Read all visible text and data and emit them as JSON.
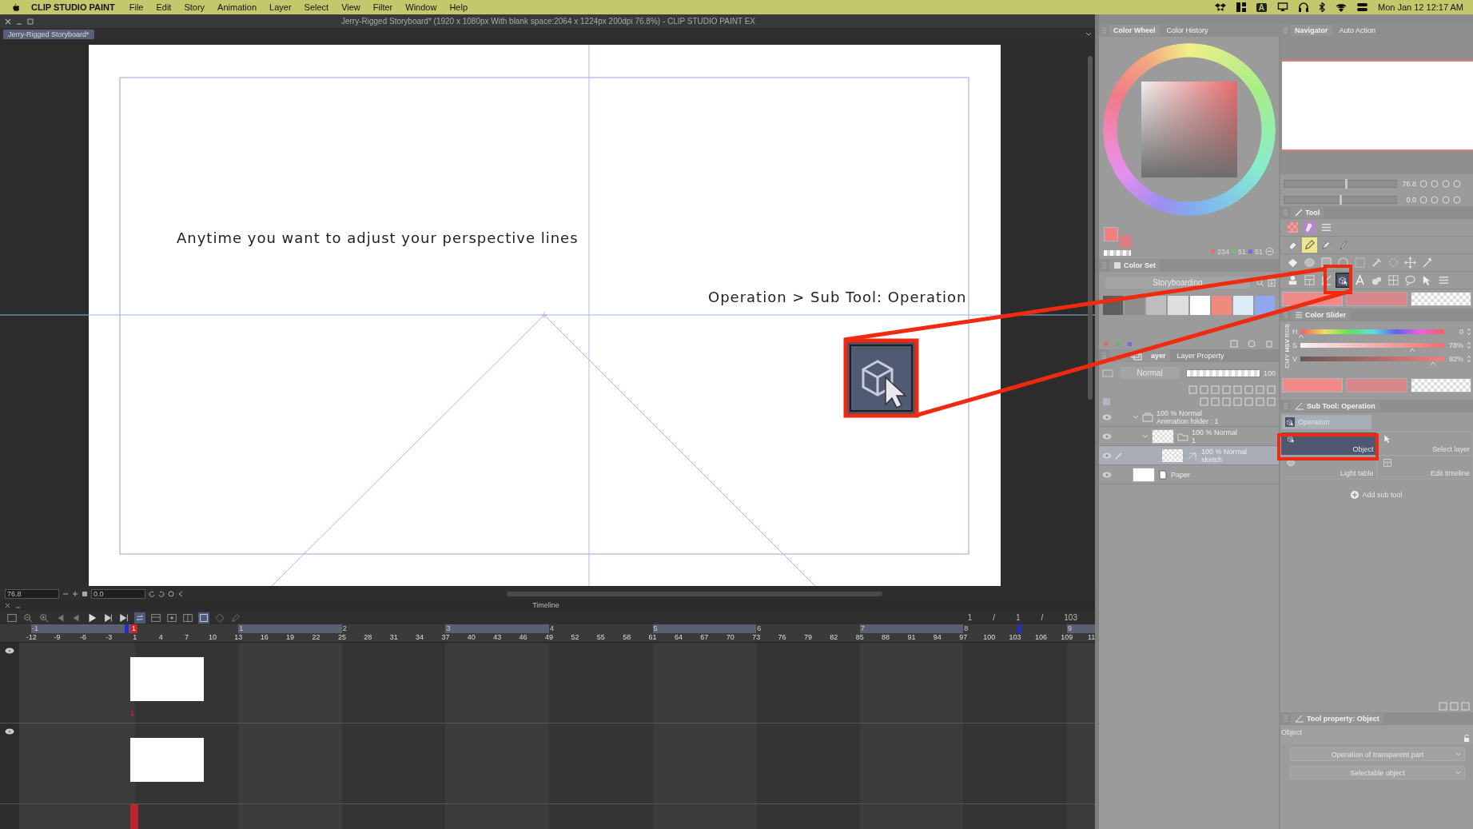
{
  "menu_bar": {
    "app_name": "CLIP STUDIO PAINT",
    "menus": [
      "File",
      "Edit",
      "Story",
      "Animation",
      "Layer",
      "Select",
      "View",
      "Filter",
      "Window",
      "Help"
    ],
    "input_source": "A",
    "clock": "Mon Jan 12  12:17 AM"
  },
  "window": {
    "title": "Jerry-Rigged Storyboard* (1920 x 1080px With blank space:2064 x 1224px 200dpi 76.8%)  - CLIP STUDIO PAINT EX"
  },
  "document_tab": {
    "label": "Jerry-Rigged Storyboard*",
    "selected": true
  },
  "canvas": {
    "captions": [
      "Anytime you want to adjust your perspective lines",
      "Operation > Sub Tool: Operation"
    ]
  },
  "canvas_status": {
    "zoom": "76.8",
    "angle": "0.0"
  },
  "timeline": {
    "title": "Timeline",
    "frame_counter": [
      "1",
      "/",
      "1",
      "/",
      "103"
    ],
    "major_marks": [
      "-1",
      "1",
      "2",
      "3",
      "4",
      "5",
      "6",
      "7",
      "8",
      "9"
    ],
    "minor_marks": [
      "-12",
      "-9",
      "-6",
      "-3",
      "1",
      "4",
      "7",
      "10",
      "13",
      "16",
      "19",
      "22",
      "25",
      "28",
      "31",
      "34",
      "37",
      "40",
      "43",
      "46",
      "49",
      "52",
      "55",
      "58",
      "61",
      "64",
      "67",
      "70",
      "73",
      "76",
      "79",
      "82",
      "85",
      "88",
      "91",
      "94",
      "97",
      "100",
      "103",
      "106",
      "109",
      "11"
    ],
    "playhead_label": "1",
    "tracks": [
      {
        "visible": true,
        "cell_label": "1"
      },
      {
        "visible": true
      }
    ]
  },
  "color_wheel_panel": {
    "tabs": [
      {
        "label": "Color Wheel",
        "selected": true
      },
      {
        "label": "Color History",
        "selected": false
      }
    ],
    "rgb": [
      "234",
      "51",
      "51"
    ]
  },
  "color_set_panel": {
    "title": "Color Set",
    "set_name": "Storyboarding",
    "swatches": [
      {
        "color": "#5e5e5e"
      },
      {
        "color": "#8e8e8e"
      },
      {
        "color": "#bdbdbd"
      },
      {
        "color": "#dedede"
      },
      {
        "color": "#ffffff"
      },
      {
        "color": "#f08a7e"
      },
      {
        "color": "#dcecf7"
      },
      {
        "color": "#8fa8ee"
      }
    ]
  },
  "layer_panel": {
    "tabs": [
      {
        "label": "ayer",
        "selected": true
      },
      {
        "label": "Layer Property",
        "selected": false
      }
    ],
    "blend_mode": "Normal",
    "opacity": "100",
    "opacity_slider": {
      "level": 1
    },
    "layers": [
      {
        "kind": "animation-folder",
        "mode": "100 % Normal",
        "name": "Animation folder : 1",
        "selected": false,
        "expanded": true,
        "children": [
          {
            "kind": "folder",
            "mode": "100 % Normal",
            "name": "1",
            "selected": false,
            "expanded": true,
            "children": [
              {
                "kind": "raster",
                "mode": "100 % Normal",
                "name": "sketch",
                "selected": true
              }
            ]
          }
        ]
      },
      {
        "kind": "paper",
        "name": "Paper",
        "selected": false
      }
    ]
  },
  "navigator_panel": {
    "tabs": [
      {
        "label": "Navigator",
        "selected": true
      },
      {
        "label": "Auto Action",
        "selected": false
      }
    ],
    "sliders": [
      {
        "reading": "76.8",
        "level": 0.55
      },
      {
        "reading": "0.0",
        "level": 0.5
      }
    ]
  },
  "tool_panel": {
    "title": "Tool",
    "rows": [
      [
        {
          "kind": "pattern",
          "selected": false,
          "highlighted": false
        },
        {
          "kind": "bottle",
          "selected": false,
          "highlighted": false
        },
        {
          "kind": "menu",
          "selected": false,
          "highlighted": false
        }
      ],
      [
        {
          "kind": "eraser",
          "selected": false,
          "highlighted": false
        },
        {
          "kind": "pencil",
          "selected": false,
          "highlighted": true
        },
        {
          "kind": "pen",
          "selected": false,
          "highlighted": false
        },
        {
          "kind": "brush",
          "selected": false,
          "highlighted": false
        }
      ],
      [
        {
          "kind": "fill",
          "selected": false,
          "highlighted": false
        },
        {
          "kind": "blend",
          "selected": false,
          "highlighted": false
        },
        {
          "kind": "gradient",
          "selected": false,
          "highlighted": false
        },
        {
          "kind": "circle",
          "selected": false,
          "highlighted": false
        },
        {
          "kind": "rect",
          "selected": false,
          "highlighted": false
        },
        {
          "kind": "eyedropper",
          "selected": false,
          "highlighted": false
        },
        {
          "kind": "lasso",
          "selected": false,
          "highlighted": false
        },
        {
          "kind": "move",
          "selected": false,
          "highlighted": false
        },
        {
          "kind": "wand",
          "selected": false,
          "highlighted": false
        }
      ],
      [
        {
          "kind": "stamp",
          "selected": false,
          "highlighted": false
        },
        {
          "kind": "frame",
          "selected": false,
          "highlighted": false
        },
        {
          "kind": "ruler",
          "selected": false,
          "highlighted": false
        },
        {
          "kind": "operation",
          "selected": true,
          "highlighted": false
        },
        {
          "kind": "text",
          "selected": false,
          "highlighted": false
        },
        {
          "kind": "water",
          "selected": false,
          "highlighted": false
        },
        {
          "kind": "grid",
          "selected": false,
          "highlighted": false
        },
        {
          "kind": "balloon",
          "selected": false,
          "highlighted": false
        },
        {
          "kind": "cursor",
          "selected": false,
          "highlighted": false
        },
        {
          "kind": "menu",
          "selected": false,
          "highlighted": false
        }
      ]
    ]
  },
  "color_slider_panel": {
    "title": "Color Slider",
    "modes": [
      {
        "label": "RGB",
        "selected": false
      },
      {
        "label": "HSV",
        "selected": true
      },
      {
        "label": "CMY",
        "selected": false
      }
    ],
    "sliders": [
      {
        "kind": "hue",
        "label": "H",
        "reading": "0",
        "level": 0
      },
      {
        "kind": "saturation",
        "label": "S",
        "reading": "78%",
        "level": 0.78
      },
      {
        "kind": "value",
        "label": "V",
        "reading": "92%",
        "level": 0.92
      }
    ]
  },
  "sub_tool_panel": {
    "title": "Sub Tool: Operation",
    "group": "Operation",
    "items": [
      {
        "kind": "object",
        "label": "Object",
        "selected": true
      },
      {
        "kind": "select-layer",
        "label": "Select layer",
        "selected": false
      },
      {
        "kind": "light-table",
        "label": "Light table",
        "selected": false
      },
      {
        "kind": "edit-timeline",
        "label": "Edit timeline",
        "selected": false
      }
    ],
    "add_label": "Add sub tool"
  },
  "tool_property_panel": {
    "title": "Tool property: Object",
    "name": "Object",
    "dropdowns": [
      "Operation of transparent part",
      "Selectable object"
    ]
  }
}
